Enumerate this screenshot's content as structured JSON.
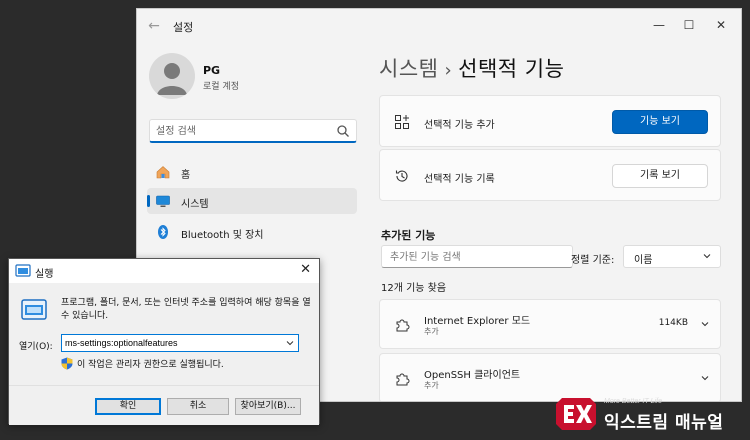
{
  "settings": {
    "title": "설정",
    "back_icon": "back-arrow-icon",
    "profile": {
      "name": "PG",
      "account": "로컬 계정"
    },
    "search_placeholder": "설정 검색",
    "nav": [
      {
        "label": "홈",
        "icon": "home-icon"
      },
      {
        "label": "시스템",
        "icon": "monitor-icon"
      },
      {
        "label": "Bluetooth 및 장치",
        "icon": "bluetooth-icon"
      }
    ],
    "breadcrumb": {
      "parent": "시스템",
      "current": "선택적 기능"
    },
    "add_card": {
      "label": "선택적 기능 추가",
      "button": "기능 보기"
    },
    "history_card": {
      "label": "선택적 기능 기록",
      "button": "기록 보기"
    },
    "added_section": {
      "title": "추가된 기능",
      "search_placeholder": "추가된 기능 검색",
      "sort_label": "정렬 기준:",
      "sort_value": "이름",
      "count_text": "12개 기능 찾음",
      "features": [
        {
          "name": "Internet Explorer 모드",
          "status": "추가",
          "size": "114KB"
        },
        {
          "name": "OpenSSH 클라이언트",
          "status": "추가",
          "size": ""
        }
      ]
    }
  },
  "run_dialog": {
    "title": "실행",
    "description": "프로그램, 폴더, 문서, 또는 인터넷 주소를 입력하여 해당 항목을 열 수 있습니다.",
    "open_label": "열기(O):",
    "command": "ms-settings:optionalfeatures",
    "admin_note": "이 작업은 관리자 권한으로 실행됩니다.",
    "buttons": {
      "ok": "확인",
      "cancel": "취소",
      "browse": "찾아보기(B)..."
    }
  },
  "watermark": {
    "tagline": "More Better IT Life",
    "name": "익스트림 매뉴얼"
  },
  "colors": {
    "accent": "#0067c0",
    "window_bg": "#f3f3f3",
    "backdrop": "#2b2b2b"
  }
}
